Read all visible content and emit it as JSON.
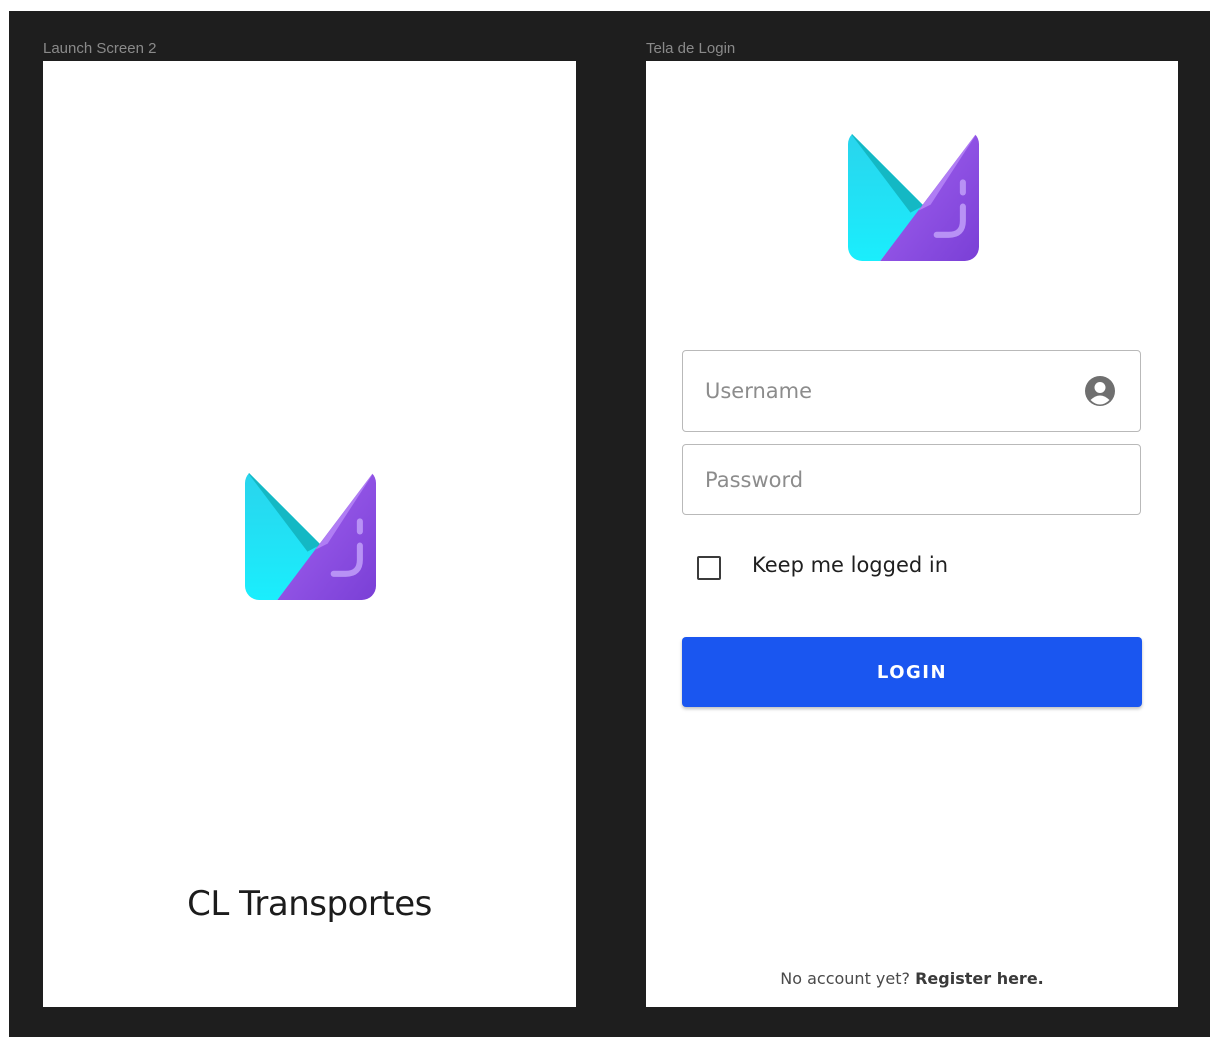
{
  "frames": {
    "launch": {
      "label": "Launch Screen 2",
      "app_name": "CL Transportes"
    },
    "login": {
      "label": "Tela de Login",
      "username": {
        "placeholder": "Username",
        "value": ""
      },
      "password": {
        "placeholder": "Password",
        "value": ""
      },
      "keep_logged_in": {
        "label": "Keep me logged in",
        "checked": false
      },
      "login_button": "LOGIN",
      "footer": {
        "text": "No account yet?",
        "link": "Register here."
      }
    }
  },
  "colors": {
    "canvas": "#1e1e1e",
    "primary": "#1a56f0",
    "logo_cyan": "#1de9f6",
    "logo_purple": "#8a4fe6"
  },
  "icons": {
    "logo": "app-logo",
    "user": "user-circle-icon"
  }
}
